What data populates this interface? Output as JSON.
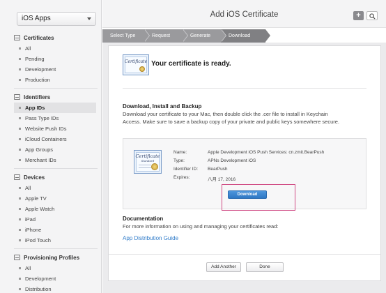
{
  "sidebar": {
    "app_select": "iOS Apps",
    "sections": [
      {
        "title": "Certificates",
        "items": [
          "All",
          "Pending",
          "Development",
          "Production"
        ]
      },
      {
        "title": "Identifiers",
        "items": [
          "App IDs",
          "Pass Type IDs",
          "Website Push IDs",
          "iCloud Containers",
          "App Groups",
          "Merchant IDs"
        ]
      },
      {
        "title": "Devices",
        "items": [
          "All",
          "Apple TV",
          "Apple Watch",
          "iPad",
          "iPhone",
          "iPod Touch"
        ]
      },
      {
        "title": "Provisioning Profiles",
        "items": [
          "All",
          "Development",
          "Distribution"
        ]
      }
    ],
    "active_item": "App IDs"
  },
  "header": {
    "title": "Add iOS Certificate",
    "add_icon": "plus-icon",
    "search_icon": "search-icon"
  },
  "steps": [
    "Select Type",
    "Request",
    "Generate",
    "Download"
  ],
  "main": {
    "ready_text": "Your certificate is ready.",
    "download_heading": "Download, Install and Backup",
    "download_text_1": "Download your certificate to your Mac, then double click the .cer file to install in Keychain",
    "download_text_2": "Access. Make sure to save a backup copy of your private and public keys somewhere secure.",
    "cert_word": "Certificate",
    "cert_word_small": "Standard",
    "details": {
      "name_label": "Name:",
      "name_value": "Apple Development iOS Push Services: cn.zmit.BearPush",
      "type_label": "Type:",
      "type_value": "APNs Development iOS",
      "id_label": "Identifier ID:",
      "id_value": "BearPush",
      "expires_label": "Expires:",
      "expires_value": "八月 17, 2016"
    },
    "download_button": "Download",
    "doc_heading": "Documentation",
    "doc_text": "For more information on using and managing your certificates read:",
    "doc_link": "App Distribution Guide"
  },
  "footer": {
    "add_another": "Add Another",
    "done": "Done"
  },
  "colors": {
    "link": "#2f7bc9",
    "download_button": "#2f78c4",
    "highlight": "#d04b84"
  }
}
